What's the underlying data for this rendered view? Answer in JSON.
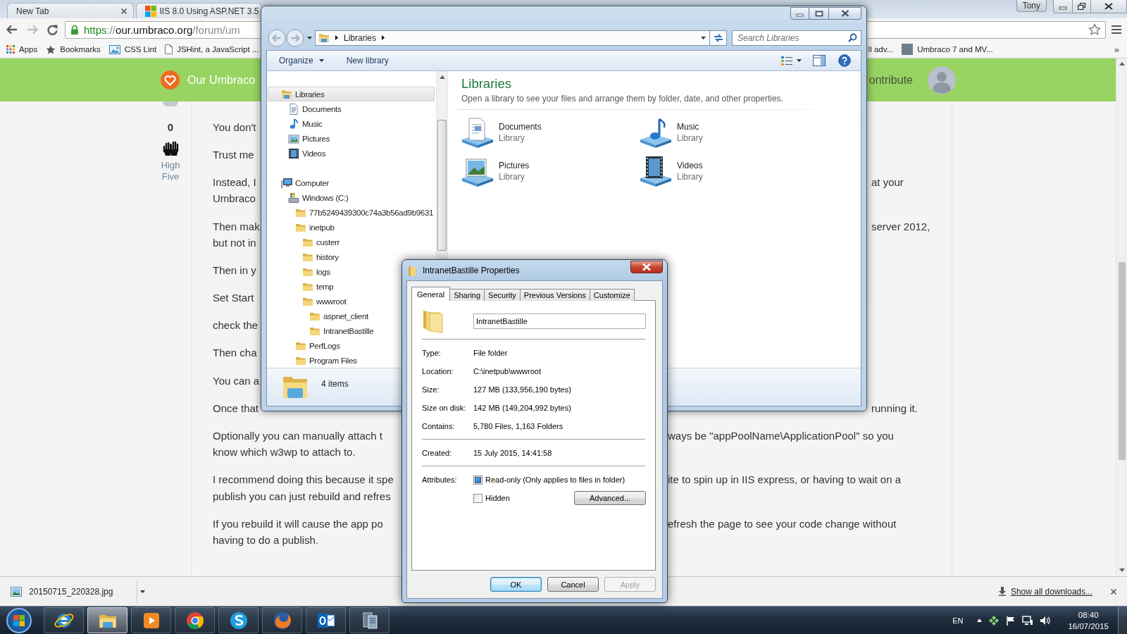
{
  "browser": {
    "tabs": [
      {
        "title": "New Tab",
        "selected": false,
        "kind": "blank"
      },
      {
        "title": "IIS 8.0 Using ASP.NET 3.5",
        "selected": false,
        "kind": "site"
      }
    ],
    "profile": "Tony",
    "address": {
      "secure": true,
      "scheme": "https",
      "separator": "://",
      "host": "our.umbraco.org",
      "path": "/forum/um"
    },
    "bookmarks": [
      {
        "kind": "apps",
        "label": "Apps"
      },
      {
        "kind": "star",
        "label": "Bookmarks"
      },
      {
        "kind": "image",
        "label": "CSS Lint"
      },
      {
        "kind": "page",
        "label": "JSHint, a JavaScript ..."
      }
    ],
    "bookmarks_right": [
      {
        "kind": "none",
        "label": "ll adv..."
      },
      {
        "kind": "photo",
        "label": "Umbraco 7 and MV..."
      }
    ],
    "bookmarks_overflow": "»"
  },
  "site": {
    "logo": "Our Umbraco",
    "nav_fragment": "ontribute"
  },
  "post": {
    "votes": "0",
    "high_five": "High Five",
    "paragraphs": [
      {
        "lines": [
          {
            "left": "You don't"
          }
        ]
      },
      {
        "lines": [
          {
            "left": "Trust me"
          }
        ]
      },
      {
        "lines": [
          {
            "left": "Instead, I",
            "right": "at your"
          },
          {
            "left": "Umbraco"
          }
        ]
      },
      {
        "lines": [
          {
            "left": "Then mak",
            "right": "server 2012,"
          },
          {
            "left": "but not in"
          }
        ]
      },
      {
        "lines": [
          {
            "left": "Then in y"
          }
        ]
      },
      {
        "lines": [
          {
            "left": "Set Start"
          }
        ]
      },
      {
        "lines": [
          {
            "left": "check the"
          }
        ]
      },
      {
        "lines": [
          {
            "left": "Then cha"
          }
        ]
      },
      {
        "lines": [
          {
            "left": "You can a"
          }
        ]
      },
      {
        "lines": [
          {
            "left": "Once that",
            "right": "running it."
          }
        ]
      },
      {
        "lines": [
          {
            "left": "Optionally you can manually attach t",
            "right": "ways be \"appPoolName\\ApplicationPool\" so you"
          },
          {
            "left": "know which w3wp to attach to."
          }
        ]
      },
      {
        "lines": [
          {
            "left": "I recommend doing this because it spe",
            "right": "ite to spin up in IIS express, or having to wait on a"
          },
          {
            "left": "publish you can just rebuild and refres"
          }
        ]
      },
      {
        "lines": [
          {
            "left": "If you rebuild it will cause the app po",
            "right": "efresh the page to see your code change without"
          },
          {
            "left": "having to do a publish."
          }
        ]
      }
    ]
  },
  "explorer": {
    "breadcrumb": [
      "Libraries"
    ],
    "search": {
      "placeholder": "Search Libraries"
    },
    "toolbar": [
      {
        "label": "Organize",
        "menu": true
      },
      {
        "label": "New library",
        "menu": false
      }
    ],
    "nav": [
      {
        "label": "Libraries",
        "kind": "library",
        "selected": true,
        "children": [
          {
            "label": "Documents",
            "kind": "documents",
            "selected": false
          },
          {
            "label": "Music",
            "kind": "music",
            "selected": false
          },
          {
            "label": "Pictures",
            "kind": "pictures",
            "selected": false
          },
          {
            "label": "Videos",
            "kind": "videos",
            "selected": false
          }
        ]
      },
      {
        "label": "Computer",
        "kind": "computer",
        "selected": false,
        "children": [
          {
            "label": "Windows (C:)",
            "kind": "drive",
            "selected": false,
            "children": [
              {
                "label": "77b5249439300c74a3b56ad9b9631",
                "kind": "folder",
                "selected": false
              },
              {
                "label": "inetpub",
                "kind": "folder",
                "selected": false,
                "children": [
                  {
                    "label": "custerr",
                    "kind": "folder",
                    "selected": false
                  },
                  {
                    "label": "history",
                    "kind": "folder",
                    "selected": false
                  },
                  {
                    "label": "logs",
                    "kind": "folder",
                    "selected": false
                  },
                  {
                    "label": "temp",
                    "kind": "folder",
                    "selected": false
                  },
                  {
                    "label": "wwwroot",
                    "kind": "folder",
                    "selected": false,
                    "children": [
                      {
                        "label": "aspnet_client",
                        "kind": "folder",
                        "selected": false
                      },
                      {
                        "label": "IntranetBastille",
                        "kind": "folder",
                        "selected": false
                      }
                    ]
                  }
                ]
              },
              {
                "label": "PerfLogs",
                "kind": "folder",
                "selected": false
              },
              {
                "label": "Program Files",
                "kind": "folder",
                "selected": false
              }
            ]
          }
        ]
      }
    ],
    "heading": "Libraries",
    "subtitle": "Open a library to see your files and arrange them by folder, date, and other properties.",
    "libraries": [
      {
        "name": "Documents",
        "type": "Library",
        "kind": "documents"
      },
      {
        "name": "Music",
        "type": "Library",
        "kind": "music"
      },
      {
        "name": "Pictures",
        "type": "Library",
        "kind": "pictures"
      },
      {
        "name": "Videos",
        "type": "Library",
        "kind": "videos"
      }
    ],
    "status": "4 items"
  },
  "properties": {
    "title": "IntranetBastille Properties",
    "tabs": [
      {
        "label": "General",
        "selected": true
      },
      {
        "label": "Sharing",
        "selected": false
      },
      {
        "label": "Security",
        "selected": false
      },
      {
        "label": "Previous Versions",
        "selected": false
      },
      {
        "label": "Customize",
        "selected": false
      }
    ],
    "name": "IntranetBastille",
    "details": [
      {
        "label": "Type:",
        "value": "File folder"
      },
      {
        "label": "Location:",
        "value": "C:\\inetpub\\wwwroot"
      },
      {
        "label": "Size:",
        "value": "127 MB (133,956,190 bytes)"
      },
      {
        "label": "Size on disk:",
        "value": "142 MB (149,204,992 bytes)"
      },
      {
        "label": "Contains:",
        "value": "5,780 Files, 1,163 Folders"
      }
    ],
    "dates": [
      {
        "label": "Created:",
        "value": "15 July 2015, 14:41:58"
      }
    ],
    "attributes_label": "Attributes:",
    "attributes": [
      {
        "label": "Read-only (Only applies to files in folder)",
        "checked": true
      },
      {
        "label": "Hidden",
        "checked": false
      }
    ],
    "advanced": "Advanced...",
    "buttons": [
      {
        "label": "OK",
        "default": true,
        "disabled": false
      },
      {
        "label": "Cancel",
        "default": false,
        "disabled": false
      },
      {
        "label": "Apply",
        "default": false,
        "disabled": true
      }
    ]
  },
  "downloads": {
    "file": "20150715_220328.jpg",
    "show_all": "Show all downloads..."
  },
  "taskbar": {
    "apps": [
      {
        "kind": "ie",
        "active": false
      },
      {
        "kind": "explorer",
        "active": true
      },
      {
        "kind": "media",
        "active": false
      },
      {
        "kind": "chrome",
        "active": false
      },
      {
        "kind": "skype",
        "active": false
      },
      {
        "kind": "firefox",
        "active": false
      },
      {
        "kind": "outlook",
        "active": false
      },
      {
        "kind": "network",
        "active": false
      }
    ],
    "language": "EN",
    "time": "08:40",
    "date": "16/07/2015"
  }
}
